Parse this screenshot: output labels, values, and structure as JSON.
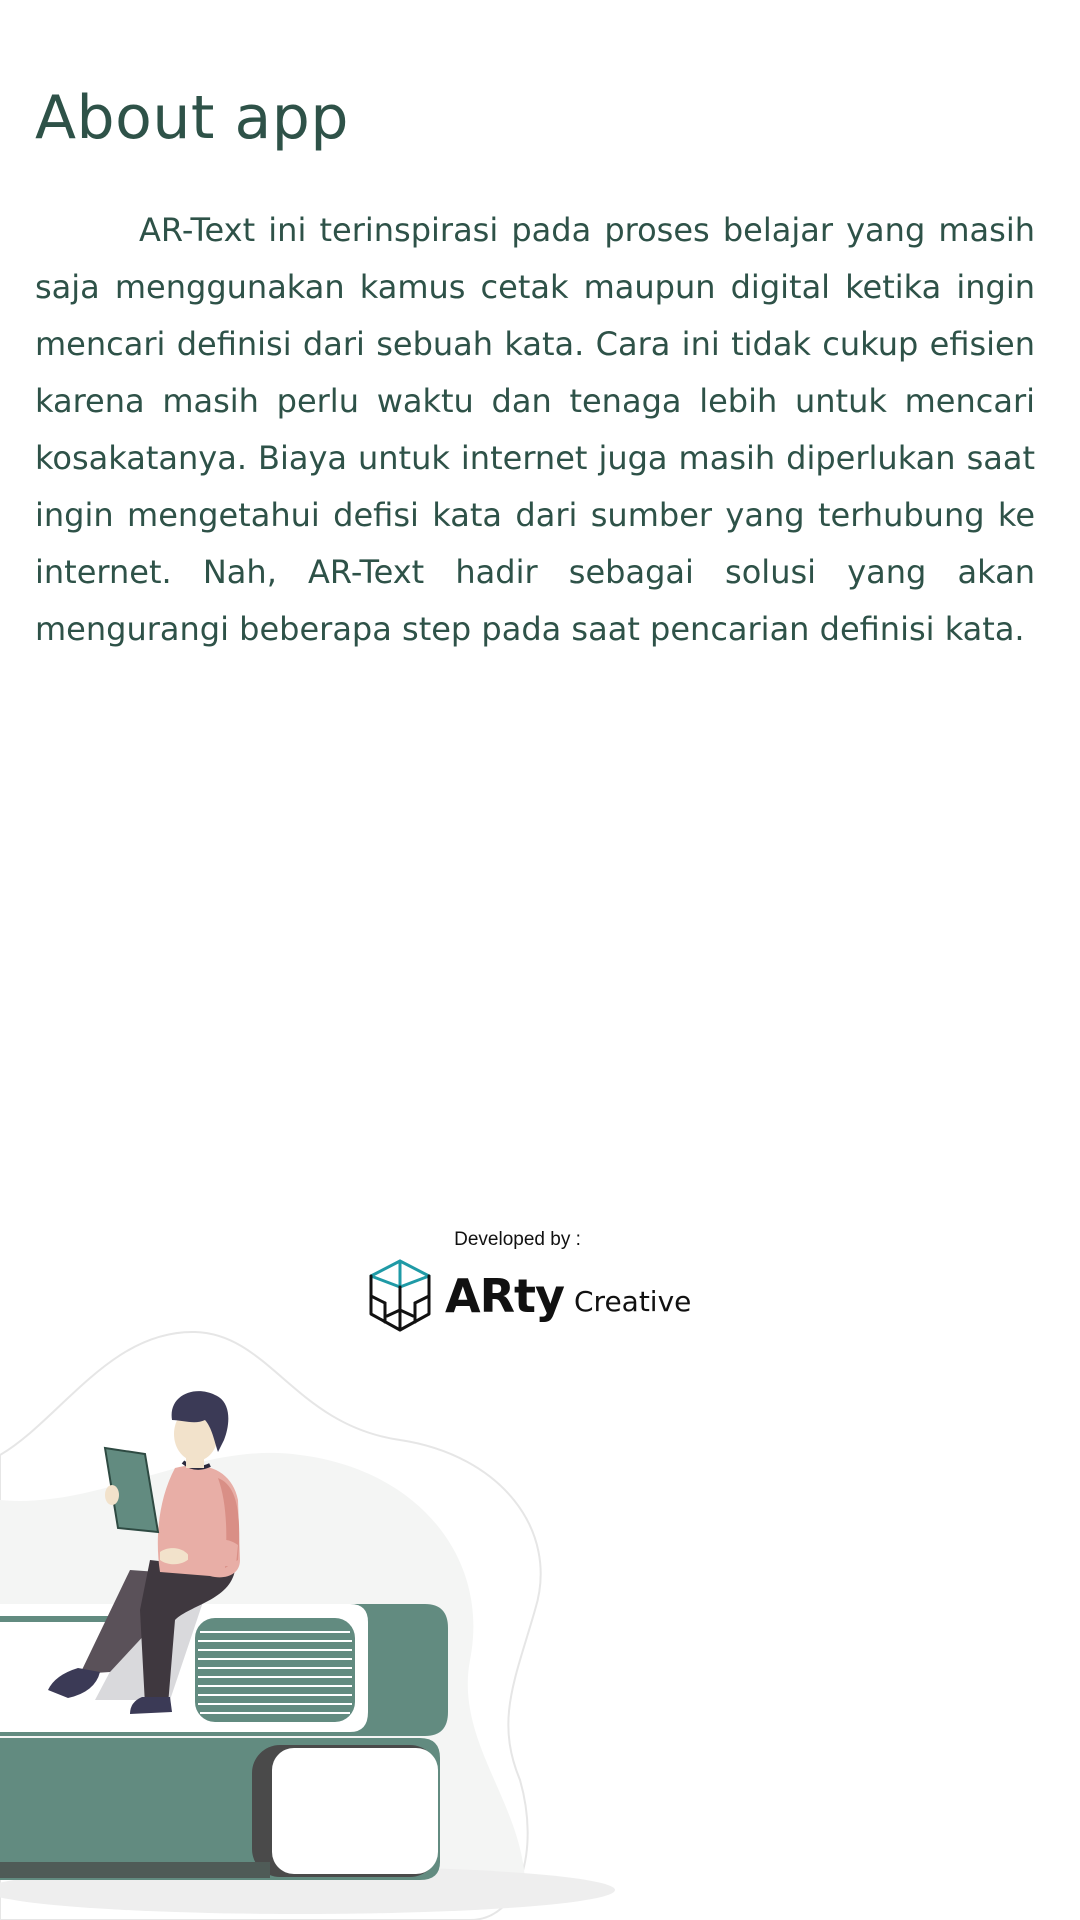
{
  "page": {
    "title": "About app",
    "description": "AR-Text ini terinspirasi pada proses belajar yang masih saja menggunakan kamus cetak maupun digital ketika ingin mencari definisi dari sebuah kata. Cara ini tidak cukup efisien karena masih perlu waktu dan tenaga lebih untuk mencari kosakatanya. Biaya untuk internet juga masih diperlukan saat ingin mengetahui defisi kata dari sumber yang terhubung ke internet. Nah, AR-Text hadir sebagai solusi yang akan mengurangi beberapa step pada saat pencarian definisi kata."
  },
  "footer": {
    "developed_by_label": "Developed by :",
    "brand_name": "ARty",
    "brand_suffix": "Creative",
    "logo_icon": "cube-logo-icon"
  },
  "illustration": {
    "icon": "person-reading-on-books-illustration"
  },
  "colors": {
    "text_primary": "#2e5248",
    "book_green": "#628b80",
    "book_dark": "#4a4a4a",
    "shirt_pink": "#e8aea6",
    "pants_dark": "#3f383f",
    "logo_teal": "#1f9aa6"
  }
}
